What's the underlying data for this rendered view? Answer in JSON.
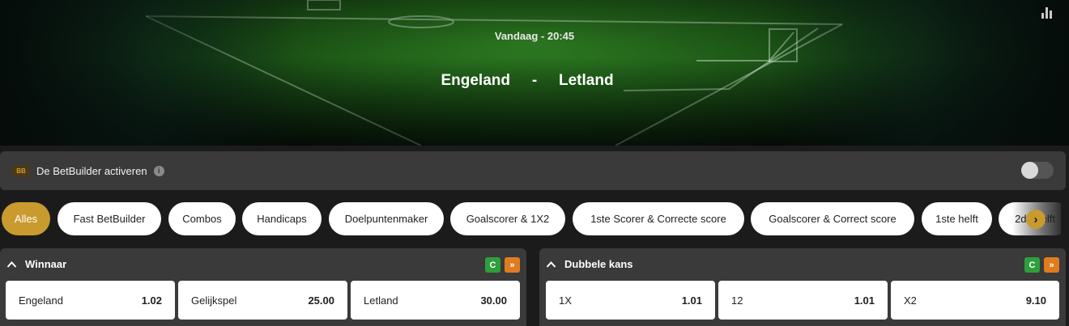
{
  "match": {
    "time": "Vandaag - 20:45",
    "home": "Engeland",
    "separator": "-",
    "away": "Letland"
  },
  "betbuilder": {
    "badge": "BB",
    "label": "De BetBuilder activeren",
    "info": "i",
    "enabled": false
  },
  "filters": [
    {
      "label": "Alles",
      "active": true
    },
    {
      "label": "Fast BetBuilder"
    },
    {
      "label": "Combos"
    },
    {
      "label": "Handicaps"
    },
    {
      "label": "Doelpuntenmaker"
    },
    {
      "label": "Goalscorer & 1X2"
    },
    {
      "label": "1ste Scorer & Correcte score"
    },
    {
      "label": "Goalscorer & Correct score"
    },
    {
      "label": "1ste helft"
    },
    {
      "label": "2de helft"
    }
  ],
  "filters_next": "›",
  "markets": [
    {
      "title": "Winnaar",
      "icon_g": "C",
      "icon_o": "»",
      "outcomes": [
        {
          "label": "Engeland",
          "odds": "1.02"
        },
        {
          "label": "Gelijkspel",
          "odds": "25.00"
        },
        {
          "label": "Letland",
          "odds": "30.00"
        }
      ]
    },
    {
      "title": "Dubbele kans",
      "icon_g": "C",
      "icon_o": "»",
      "outcomes": [
        {
          "label": "1X",
          "odds": "1.01"
        },
        {
          "label": "12",
          "odds": "1.01"
        },
        {
          "label": "X2",
          "odds": "9.10"
        }
      ]
    }
  ],
  "colors": {
    "accent": "#c99a2e",
    "panel": "#3a3a3a",
    "background": "#1b1b1b",
    "cashout_green": "#2f9e3c",
    "quick_orange": "#e07c1f"
  }
}
